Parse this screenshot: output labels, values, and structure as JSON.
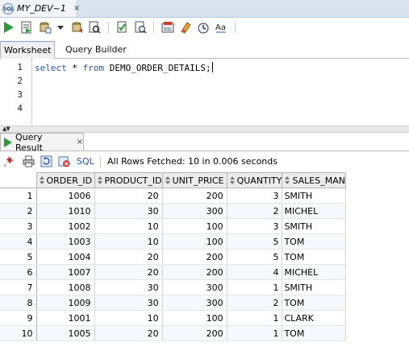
{
  "document_tab": {
    "title": "MY_DEV~1",
    "close": "×",
    "icon": "sql-worksheet-icon"
  },
  "toolbar": {
    "buttons": [
      "run-statement-icon",
      "run-script-icon",
      "commit-icon",
      "dropdown-arrow-icon",
      "rollback-icon",
      "explain-plan-icon",
      "autotrace-icon",
      "sql-tuning-icon",
      "unshared-sql-icon",
      "clear-icon",
      "history-icon",
      "format-case-icon"
    ]
  },
  "worksheet_tabs": {
    "worksheet": "Worksheet",
    "query_builder": "Query Builder"
  },
  "editor": {
    "line_numbers": [
      "1",
      "2",
      "3",
      "4"
    ],
    "kw_select": "select",
    "star": " * ",
    "kw_from": "from",
    "table_stmt": " DEMO_ORDER_DETAILS;"
  },
  "result_tab": {
    "label": "Query Result",
    "close": "×"
  },
  "result_toolbar": {
    "sql_label": "SQL",
    "status": "All Rows Fetched: 10 in 0.006 seconds"
  },
  "grid": {
    "columns": [
      "ORDER_ID",
      "PRODUCT_ID",
      "UNIT_PRICE",
      "QUANTITY",
      "SALES_MAN"
    ],
    "rows": [
      [
        "1",
        "1006",
        "20",
        "200",
        "3",
        "SMITH"
      ],
      [
        "2",
        "1010",
        "30",
        "300",
        "2",
        "MICHEL"
      ],
      [
        "3",
        "1002",
        "10",
        "100",
        "3",
        "SMITH"
      ],
      [
        "4",
        "1003",
        "10",
        "100",
        "5",
        "TOM"
      ],
      [
        "5",
        "1004",
        "20",
        "200",
        "5",
        "TOM"
      ],
      [
        "6",
        "1007",
        "20",
        "200",
        "4",
        "MICHEL"
      ],
      [
        "7",
        "1008",
        "30",
        "300",
        "1",
        "SMITH"
      ],
      [
        "8",
        "1009",
        "30",
        "300",
        "2",
        "TOM"
      ],
      [
        "9",
        "1001",
        "10",
        "100",
        "1",
        "CLARK"
      ],
      [
        "10",
        "1005",
        "20",
        "200",
        "1",
        "TOM"
      ]
    ]
  }
}
